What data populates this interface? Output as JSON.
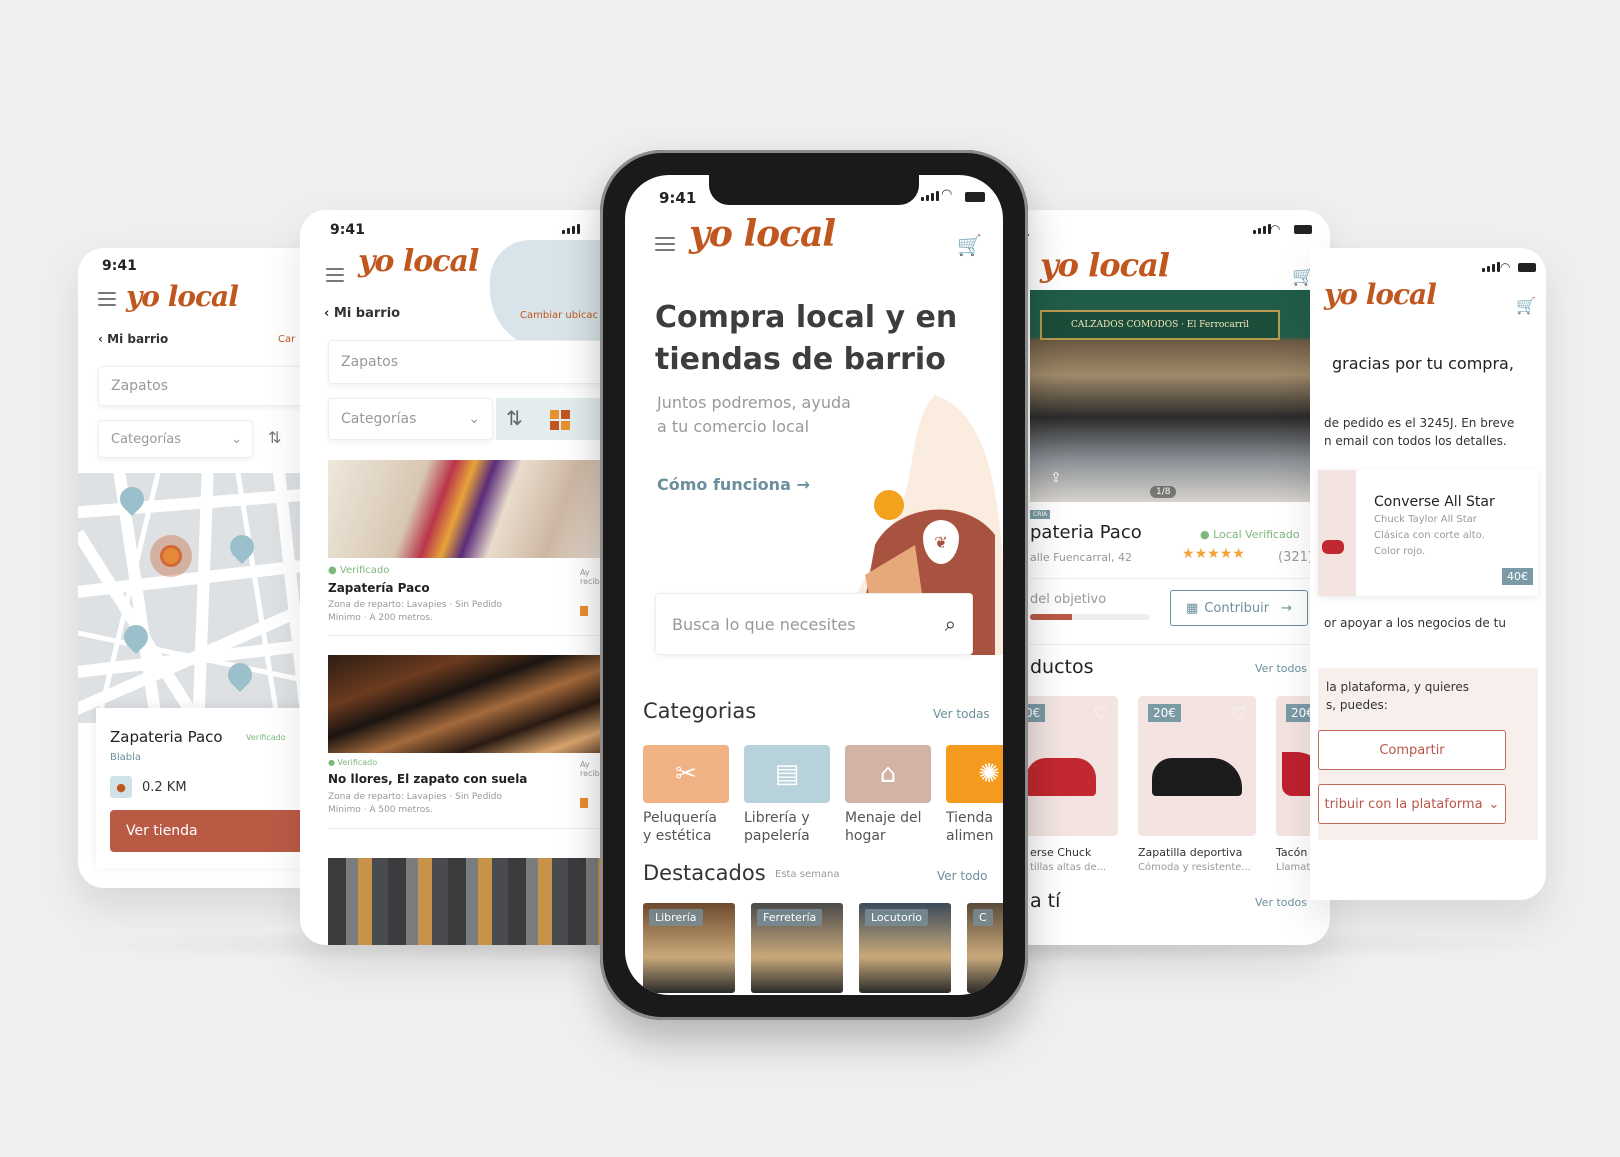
{
  "status_time": "9:41",
  "logo_text": "yo local",
  "colors": {
    "brand": "#c0571f",
    "brand_button": "#b95a45",
    "teal": "#6b8f9c",
    "verified": "#7cb87c",
    "star": "#f2a43a"
  },
  "screen1": {
    "back_label": "Mi barrio",
    "change_link": "Car",
    "search_value": "Zapatos",
    "categories_label": "Categorías",
    "shop_name": "Zapateria Paco",
    "verified": "Verificado",
    "shop_subtitle": "Blabla",
    "distance": "0.2 KM",
    "cta": "Ver tienda"
  },
  "screen2": {
    "back_label": "Mi barrio",
    "change_link": "Cambiar ubicac",
    "search_value": "Zapatos",
    "categories_label": "Categorías",
    "items": [
      {
        "verified": "Verificado",
        "name": "Zapatería Paco",
        "line1": "Zona de reparto: Lavapies · Sin Pedido",
        "line2": "Mínimo · A 200 metros.",
        "side": "Ay recib"
      },
      {
        "verified": "Verificado",
        "name": "No llores, El zapato con suela",
        "line1": "Zona de reparto: Lavapies · Sin Pedido",
        "line2": "Mínimo · A 500 metros.",
        "side": "Ay recib"
      }
    ]
  },
  "screen3": {
    "hero_title_1": "Compra local y en",
    "hero_title_2": "tiendas de barrio",
    "hero_sub_1": "Juntos podremos, ayuda",
    "hero_sub_2": "a tu comercio local",
    "how_link": "Cómo funciona",
    "search_placeholder": "Busca lo que necesites",
    "categories_title": "Categorias",
    "categories_link": "Ver todas",
    "categories": [
      {
        "line1": "Peluquería",
        "line2": "y estética",
        "color": "#f0b184",
        "icon": "hair-salon-icon"
      },
      {
        "line1": "Librería y",
        "line2": "papelería",
        "color": "#b7d2da",
        "icon": "book-icon"
      },
      {
        "line1": "Menaje del",
        "line2": "hogar",
        "color": "#d4b3a7",
        "icon": "store-icon"
      },
      {
        "line1": "Tienda",
        "line2": "alimen",
        "color": "#f39a1f",
        "icon": "food-icon"
      }
    ],
    "featured_title": "Destacados",
    "featured_sub": "Esta semana",
    "featured_link": "Ver todo",
    "featured": [
      {
        "tag": "Librería"
      },
      {
        "tag": "Ferretería"
      },
      {
        "tag": "Locutorio"
      },
      {
        "tag": "C"
      }
    ]
  },
  "screen4": {
    "photo_counter": "1/8",
    "badge": "CRÍA",
    "shop_name": "pateria Paco",
    "verified": "Local Verificado",
    "address": "alle Fuencarral, 42",
    "rating_count": "(321)",
    "stars": 5,
    "goal_label": "del objetivo",
    "goal_progress": 0.35,
    "contribute": "Contribuir",
    "products_title": "ductos",
    "products_link": "Ver todos",
    "products": [
      {
        "price": "0€",
        "name": "erse Chuck",
        "desc": "tillas altas de..."
      },
      {
        "price": "20€",
        "name": "Zapatilla deportiva",
        "desc": "Cómoda y resistente..."
      },
      {
        "price": "20€",
        "name": "Tacón te",
        "desc": "Llamativ"
      }
    ],
    "foryou_title": "a tí",
    "foryou_link": "Ver todos"
  },
  "screen5": {
    "thanks_line": "gracias por tu compra,",
    "order_line1": "de pedido es el 3245J. En breve",
    "order_line2": "n email con todos los detalles.",
    "product_name": "Converse All Star",
    "product_desc1": "Chuck Taylor All Star",
    "product_desc2": "Clásica con corte alto.",
    "product_desc3": "Color rojo.",
    "product_price": "40€",
    "support_line": "or apoyar a los negocios de tu",
    "platform_line1": "la plataforma, y quieres",
    "platform_line2": "s, puedes:",
    "share_btn": "Compartir",
    "contrib_btn": "tribuir con la plataforma"
  }
}
